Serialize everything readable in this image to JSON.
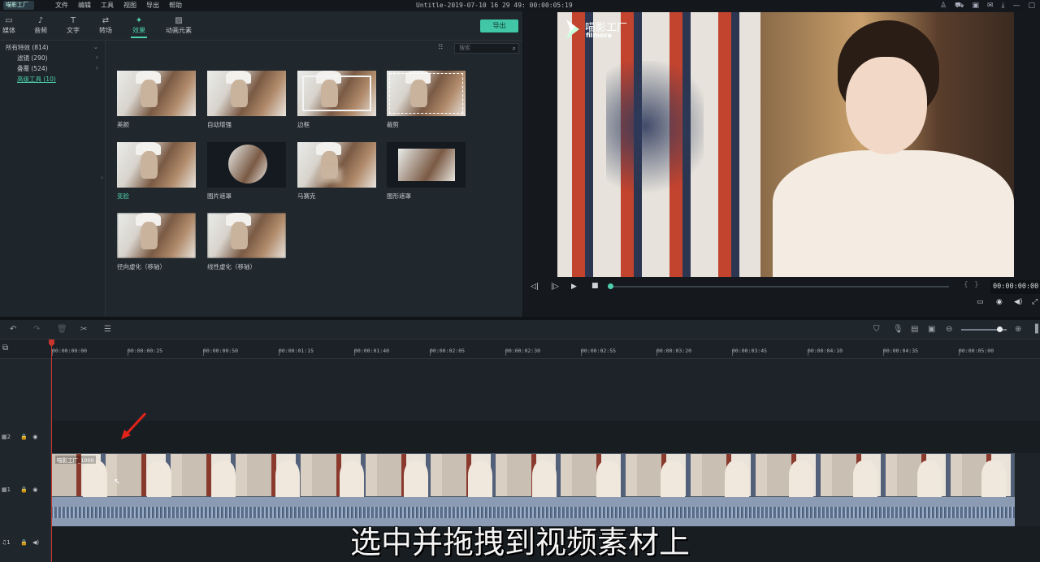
{
  "titlebar": {
    "logo": "喵影工厂",
    "menu": [
      "文件",
      "编辑",
      "工具",
      "视图",
      "导出",
      "帮助"
    ],
    "title": "Untitle-2019-07-10 16 29 49: 00:00:05:19"
  },
  "tabs": [
    {
      "label": "媒体",
      "icon": "folder-icon"
    },
    {
      "label": "音频",
      "icon": "music-note-icon"
    },
    {
      "label": "文字",
      "icon": "text-icon"
    },
    {
      "label": "转场",
      "icon": "transition-icon"
    },
    {
      "label": "效果",
      "icon": "effects-icon",
      "active": true
    },
    {
      "label": "动画元素",
      "icon": "image-icon"
    }
  ],
  "export_label": "导出",
  "sidebar": {
    "items": [
      {
        "label": "所有特效 (814)"
      },
      {
        "label": "滤镜 (290)"
      },
      {
        "label": "叠覆 (524)"
      },
      {
        "label": "高级工具 (10)"
      }
    ]
  },
  "search": {
    "placeholder": "搜索",
    "value": ""
  },
  "effects": [
    {
      "label": "美颜"
    },
    {
      "label": "自动增强"
    },
    {
      "label": "边框"
    },
    {
      "label": "裁剪"
    },
    {
      "label": "变脸"
    },
    {
      "label": "图片遮罩"
    },
    {
      "label": "马赛克"
    },
    {
      "label": "图形遮罩"
    },
    {
      "label": "径向虚化（移轴）"
    },
    {
      "label": "线性虚化（移轴）"
    }
  ],
  "preview": {
    "watermark_cn": "喵影工厂",
    "watermark_en": "filmora",
    "timecode": "00:00:00:00",
    "progress": 0
  },
  "ruler": [
    "00:00:00:00",
    "00:00:00:25",
    "00:00:00:50",
    "00:00:01:15",
    "00:00:01:40",
    "00:00:02:05",
    "00:00:02:30",
    "00:00:02:55",
    "00:00:03:20",
    "00:00:03:45",
    "00:00:04:10",
    "00:00:04:35",
    "00:00:05:00"
  ],
  "tracks": {
    "track2": "2",
    "track1": "1",
    "audio": "1",
    "clip_label": "喵影工厂_1000"
  },
  "subtitle": "选中并拖拽到视频素材上"
}
